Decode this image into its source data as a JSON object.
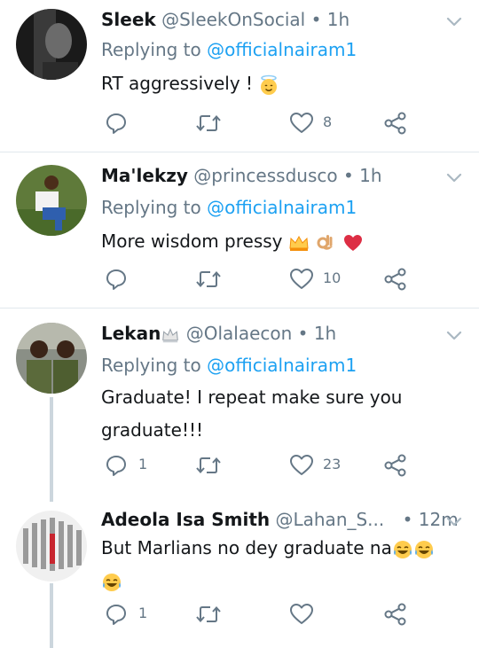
{
  "tweets": [
    {
      "name": "Sleek",
      "handle": "@SleekOnSocial",
      "dot": "•",
      "time": "1h",
      "replying_prefix": "Replying to",
      "replying_user": "@officialnairam1",
      "text": "RT aggressively !",
      "emoji": [
        "innocent-face"
      ],
      "reply_count": "",
      "retweet_count": "",
      "like_count": "8"
    },
    {
      "name": "Ma'lekzy",
      "handle": "@princessdusco",
      "dot": "•",
      "time": "1h",
      "replying_prefix": "Replying to",
      "replying_user": "@officialnairam1",
      "text": "More wisdom pressy",
      "emoji": [
        "crown",
        "ok-hand",
        "red-heart"
      ],
      "reply_count": "",
      "retweet_count": "",
      "like_count": "10"
    },
    {
      "name": "Lekan",
      "name_emoji": "crown",
      "handle": "@Olalaecon",
      "dot": "•",
      "time": "1h",
      "replying_prefix": "Replying to",
      "replying_user": "@officialnairam1",
      "text_line1": "Graduate! I repeat make sure you",
      "text_line2": "graduate!!!",
      "reply_count": "1",
      "retweet_count": "",
      "like_count": "23"
    },
    {
      "name": "Adeola Isa Smith",
      "handle": "@Lahan_S...",
      "dot": "•",
      "time": "12m",
      "text": "But Marlians no dey graduate na",
      "emoji": [
        "tears-of-joy",
        "tears-of-joy",
        "tears-of-joy"
      ],
      "reply_count": "1",
      "retweet_count": "",
      "like_count": ""
    }
  ],
  "colors": {
    "link": "#1da1f2",
    "muted": "#657786",
    "divider": "#e1e8ed",
    "thread": "#ccd6dd"
  },
  "icons": {
    "reply": "reply-bubble-icon",
    "retweet": "retweet-icon",
    "like": "heart-outline-icon",
    "share": "share-icon",
    "menu": "chevron-down-icon"
  }
}
